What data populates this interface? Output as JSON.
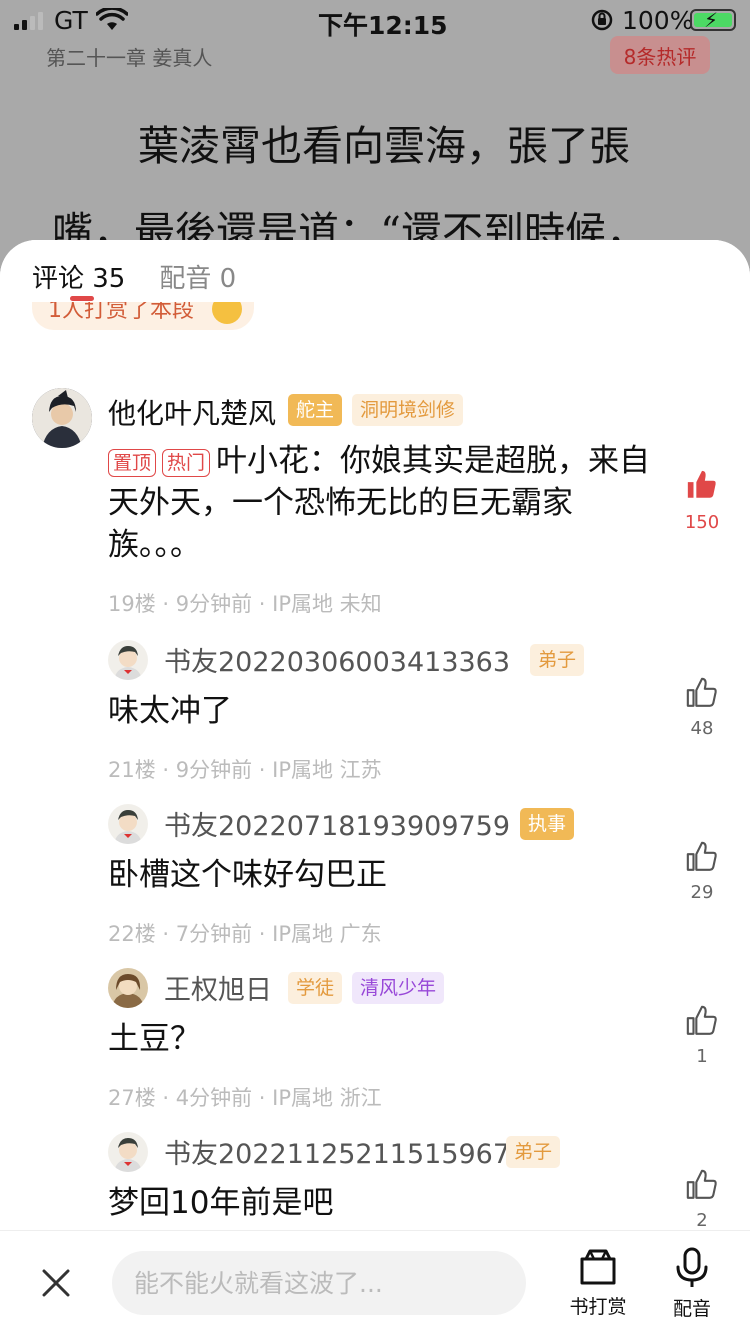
{
  "status_bar": {
    "carrier": "GT",
    "time": "下午12:15",
    "battery": "100%"
  },
  "reader": {
    "chapter": "第二十一章 姜真人",
    "hot_badge": "8条热评",
    "line1": "葉淩霄也看向雲海，張了張",
    "line2": "嘴，最後還是道：“還不到時候，"
  },
  "sheet": {
    "tabs": [
      {
        "label": "评论 35"
      },
      {
        "label": "配音 0"
      }
    ],
    "reward_banner": "1人打赏了本段"
  },
  "comments": [
    {
      "username": "他化叶凡楚风",
      "tags": [
        "舵主",
        "洞明境剑修"
      ],
      "badges": [
        "置顶",
        "热门"
      ],
      "text": "叶小花：你娘其实是超脱，来自天外天，一个恐怖无比的巨无霸家族。。。",
      "meta": "19楼 · 9分钟前 · IP属地 未知",
      "likes": "150",
      "liked": true
    },
    {
      "username": "书友20220306003413363",
      "tags": [
        "弟子"
      ],
      "text": "味太冲了",
      "meta": "21楼 · 9分钟前 · IP属地 江苏",
      "likes": "48"
    },
    {
      "username": "书友20220718193909759",
      "tags": [
        "执事"
      ],
      "text": "卧槽这个味好勾巴正",
      "meta": "22楼 · 7分钟前 · IP属地 广东",
      "likes": "29"
    },
    {
      "username": "王权旭日",
      "tags": [
        "学徒",
        "清风少年"
      ],
      "text": "土豆？",
      "meta": "27楼 · 4分钟前 · IP属地 浙江",
      "likes": "1"
    },
    {
      "username": "书友20221125211515967",
      "tags": [
        "弟子"
      ],
      "text": "梦回10年前是吧",
      "likes": "2"
    }
  ],
  "bottom_bar": {
    "input_placeholder": "能不能火就看这波了...",
    "reward_label": "书打赏",
    "dub_label": "配音"
  },
  "colors": {
    "accent_red": "#e04848",
    "tag_gold": "#f1b956"
  }
}
